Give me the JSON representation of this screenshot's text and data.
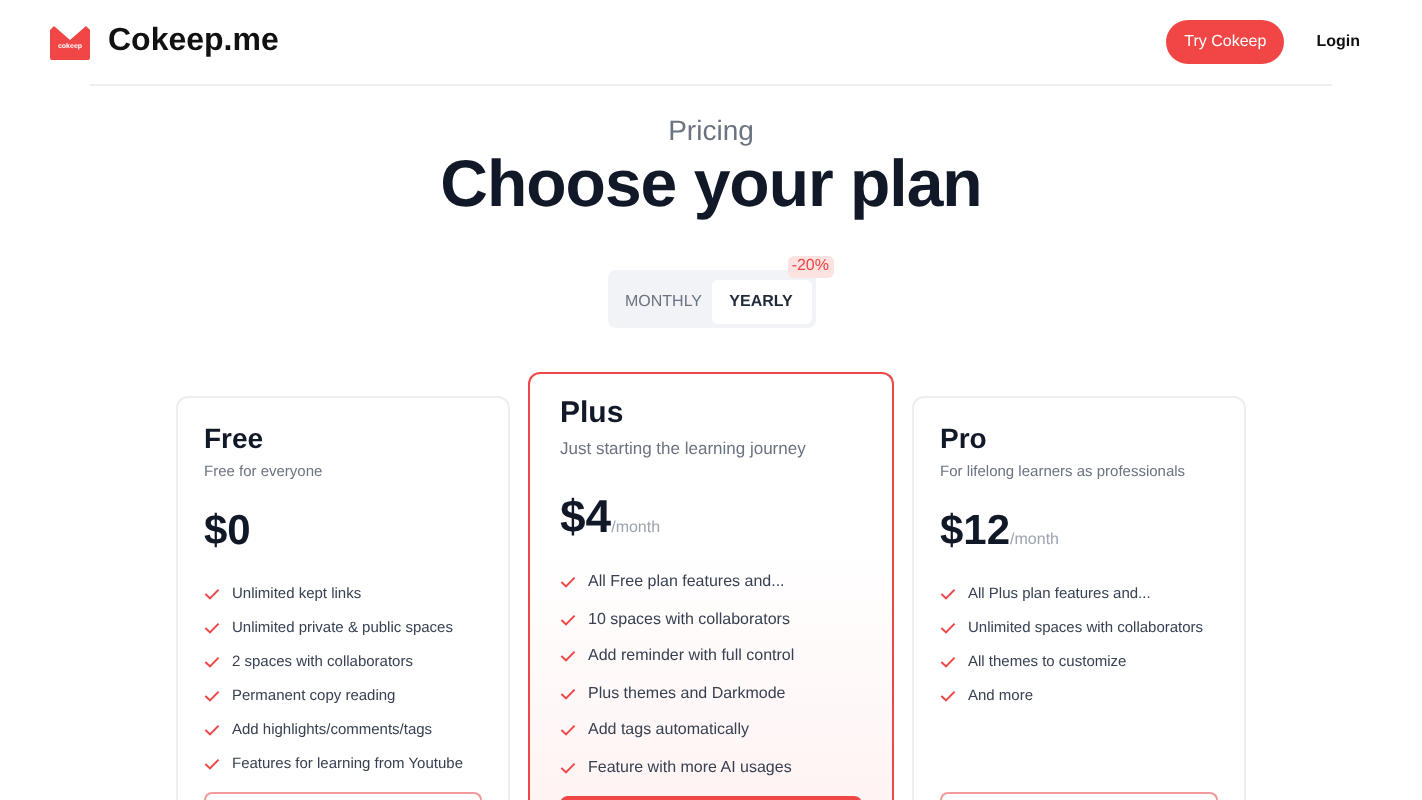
{
  "header": {
    "logo_text": "cokeep",
    "brand": "Cokeep.me",
    "cta": "Try Cokeep",
    "login": "Login"
  },
  "hero": {
    "eyebrow": "Pricing",
    "title": "Choose your plan"
  },
  "billing_toggle": [
    {
      "label": "MONTHLY",
      "selected": false
    },
    {
      "label": "YEARLY",
      "selected": true,
      "badge": "-20%"
    }
  ],
  "plans": [
    {
      "name": "Free",
      "tagline": "Free for everyone",
      "price": "$0",
      "highlighted": false,
      "features": [
        "Unlimited kept links",
        "Unlimited private & public spaces",
        "2 spaces with collaborators",
        "Permanent copy reading",
        "Add highlights/comments/tags",
        "Features for learning from Youtube"
      ]
    },
    {
      "name": "Plus",
      "tagline": "Just starting the learning journey",
      "price": "$4",
      "period": "/month",
      "highlighted": true,
      "features": [
        "All Free plan features and...",
        "10 spaces with collaborators",
        "Add reminder with full control",
        "Plus themes and Darkmode",
        "Add tags automatically",
        "Feature with more AI usages"
      ]
    },
    {
      "name": "Pro",
      "tagline": "For lifelong learners as professionals",
      "price": "$12",
      "period": "/month",
      "highlighted": false,
      "features": [
        "All Plus plan features and...",
        "Unlimited spaces with collaborators",
        "All themes to customize",
        "And more"
      ]
    }
  ]
}
